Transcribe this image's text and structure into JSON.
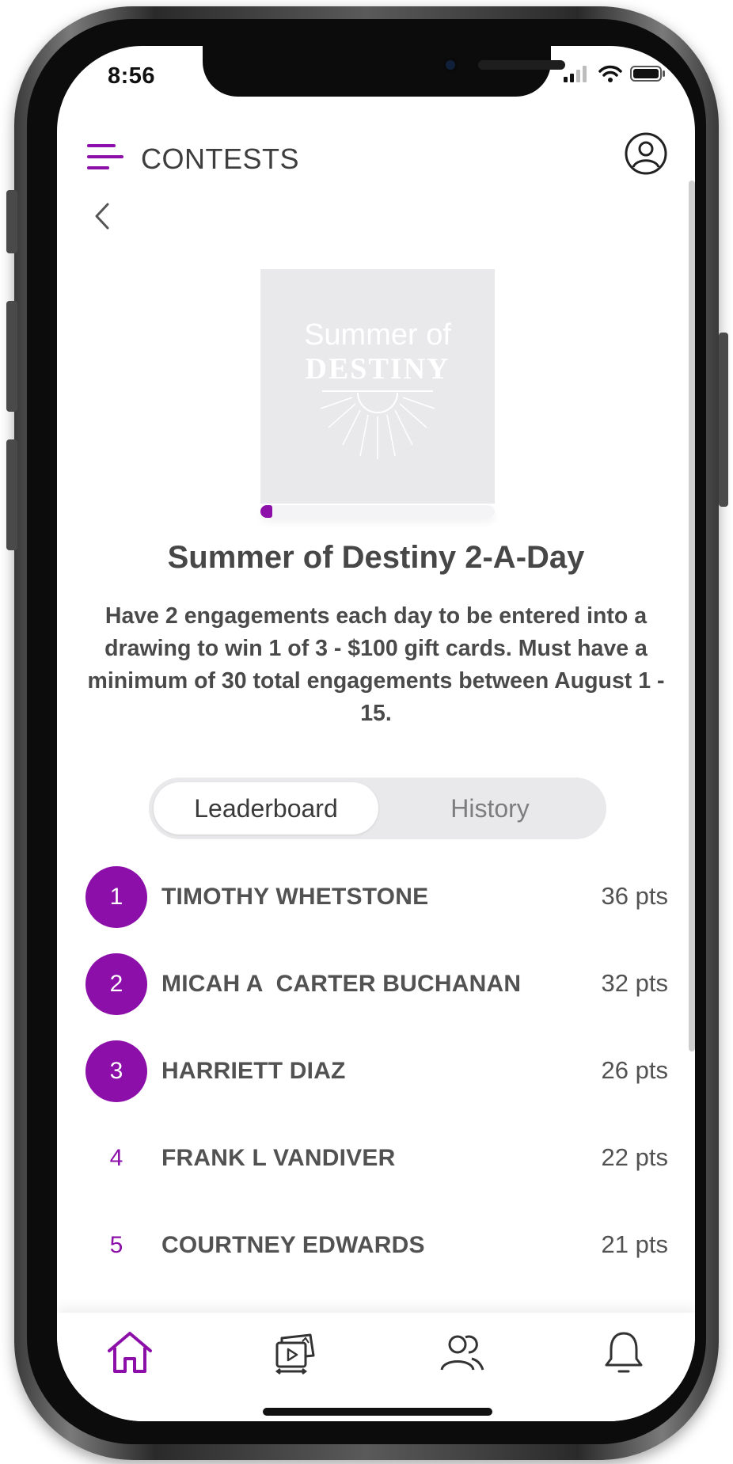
{
  "status_bar": {
    "time": "8:56"
  },
  "header": {
    "title": "CONTESTS"
  },
  "contest": {
    "image_text_line1": "Summer of",
    "image_text_line2": "DESTINY",
    "progress_fraction": 0.05,
    "title": "Summer of Destiny 2-A-Day",
    "description": "Have 2 engagements each day to be entered into a drawing to win 1 of 3 - $100 gift cards. Must have a minimum of 30 total engagements between August 1 - 15."
  },
  "tabs": {
    "leaderboard": "Leaderboard",
    "history": "History",
    "selected": "Leaderboard"
  },
  "leaderboard": [
    {
      "rank": "1",
      "name": "TIMOTHY WHETSTONE",
      "points": "36 pts"
    },
    {
      "rank": "2",
      "name": "MICAH A  CARTER BUCHANAN",
      "points": "32 pts"
    },
    {
      "rank": "3",
      "name": "HARRIETT DIAZ",
      "points": "26 pts"
    },
    {
      "rank": "4",
      "name": "FRANK L VANDIVER",
      "points": "22 pts"
    },
    {
      "rank": "5",
      "name": "COURTNEY EDWARDS",
      "points": "21 pts"
    }
  ],
  "bottom_nav": [
    {
      "icon": "home-icon",
      "selected": true
    },
    {
      "icon": "media-icon",
      "selected": false
    },
    {
      "icon": "people-icon",
      "selected": false
    },
    {
      "icon": "bell-icon",
      "selected": false
    }
  ],
  "colors": {
    "accent": "#8b0fa8",
    "text": "#4a4a4a",
    "muted": "#7d7d7d"
  }
}
